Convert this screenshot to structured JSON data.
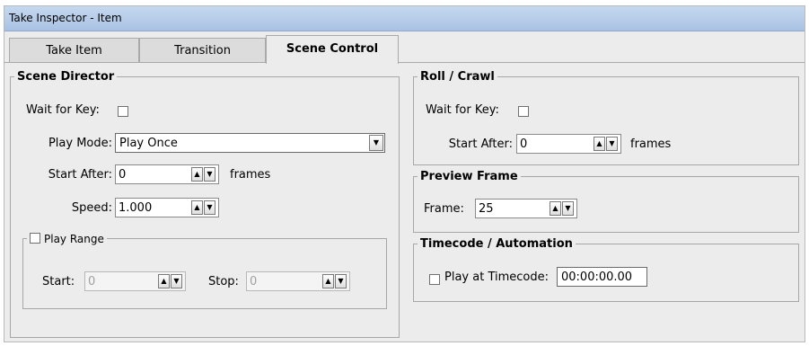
{
  "window": {
    "title": "Take Inspector - Item"
  },
  "tabs": [
    {
      "label": "Take Item"
    },
    {
      "label": "Transition"
    },
    {
      "label": "Scene Control"
    }
  ],
  "scene_director": {
    "title": "Scene Director",
    "wait_for_key_label": "Wait for Key:",
    "play_mode_label": "Play Mode:",
    "play_mode_value": "Play Once",
    "start_after_label": "Start After:",
    "start_after_value": "0",
    "start_after_units": "frames",
    "speed_label": "Speed:",
    "speed_value": "1.000",
    "play_range": {
      "label": "Play Range",
      "start_label": "Start:",
      "start_value": "0",
      "stop_label": "Stop:",
      "stop_value": "0"
    }
  },
  "roll_crawl": {
    "title": "Roll / Crawl",
    "wait_for_key_label": "Wait for Key:",
    "start_after_label": "Start After:",
    "start_after_value": "0",
    "start_after_units": "frames"
  },
  "preview_frame": {
    "title": "Preview Frame",
    "frame_label": "Frame:",
    "frame_value": "25"
  },
  "timecode": {
    "title": "Timecode / Automation",
    "play_at_label": "Play at Timecode:",
    "timecode_value": "00:00:00.00"
  },
  "icons": {
    "spin_up": "▲",
    "spin_down": "▼",
    "dropdown": "▼"
  }
}
